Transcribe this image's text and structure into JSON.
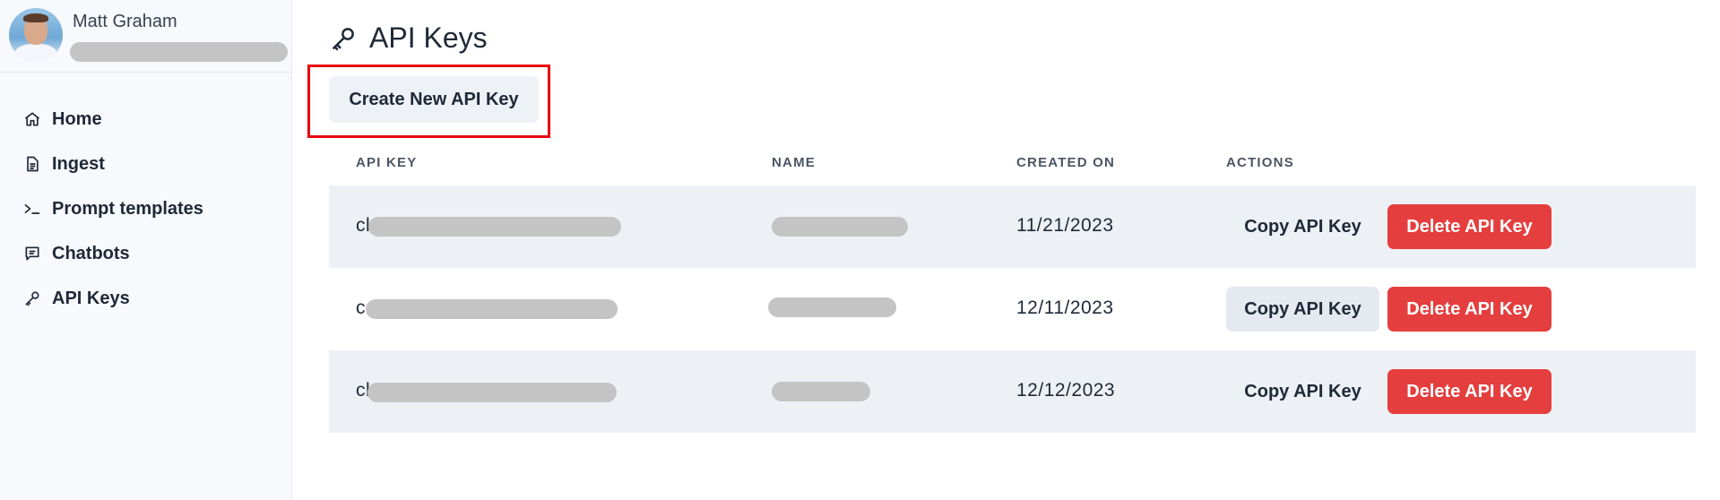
{
  "user": {
    "name": "Matt Graham"
  },
  "sidebar": {
    "items": [
      {
        "label": "Home",
        "icon": "home-icon"
      },
      {
        "label": "Ingest",
        "icon": "document-icon"
      },
      {
        "label": "Prompt templates",
        "icon": "terminal-icon"
      },
      {
        "label": "Chatbots",
        "icon": "chat-icon"
      },
      {
        "label": "API Keys",
        "icon": "key-icon"
      }
    ]
  },
  "page": {
    "title": "API Keys",
    "title_icon": "key-icon"
  },
  "toolbar": {
    "create_label": "Create New API Key",
    "highlight_color": "#e8000b"
  },
  "table": {
    "headers": [
      "API KEY",
      "NAME",
      "CREATED ON",
      "ACTIONS"
    ],
    "rows": [
      {
        "key_prefix": "cl",
        "created_on": "11/21/2023"
      },
      {
        "key_prefix": "c",
        "created_on": "12/11/2023"
      },
      {
        "key_prefix": "cl",
        "created_on": "12/12/2023"
      }
    ],
    "copy_label": "Copy API Key",
    "delete_label": "Delete API Key"
  },
  "colors": {
    "danger": "#e53e3e",
    "row_shade": "#edf1f5",
    "sidebar_bg": "#f7f9fc"
  }
}
